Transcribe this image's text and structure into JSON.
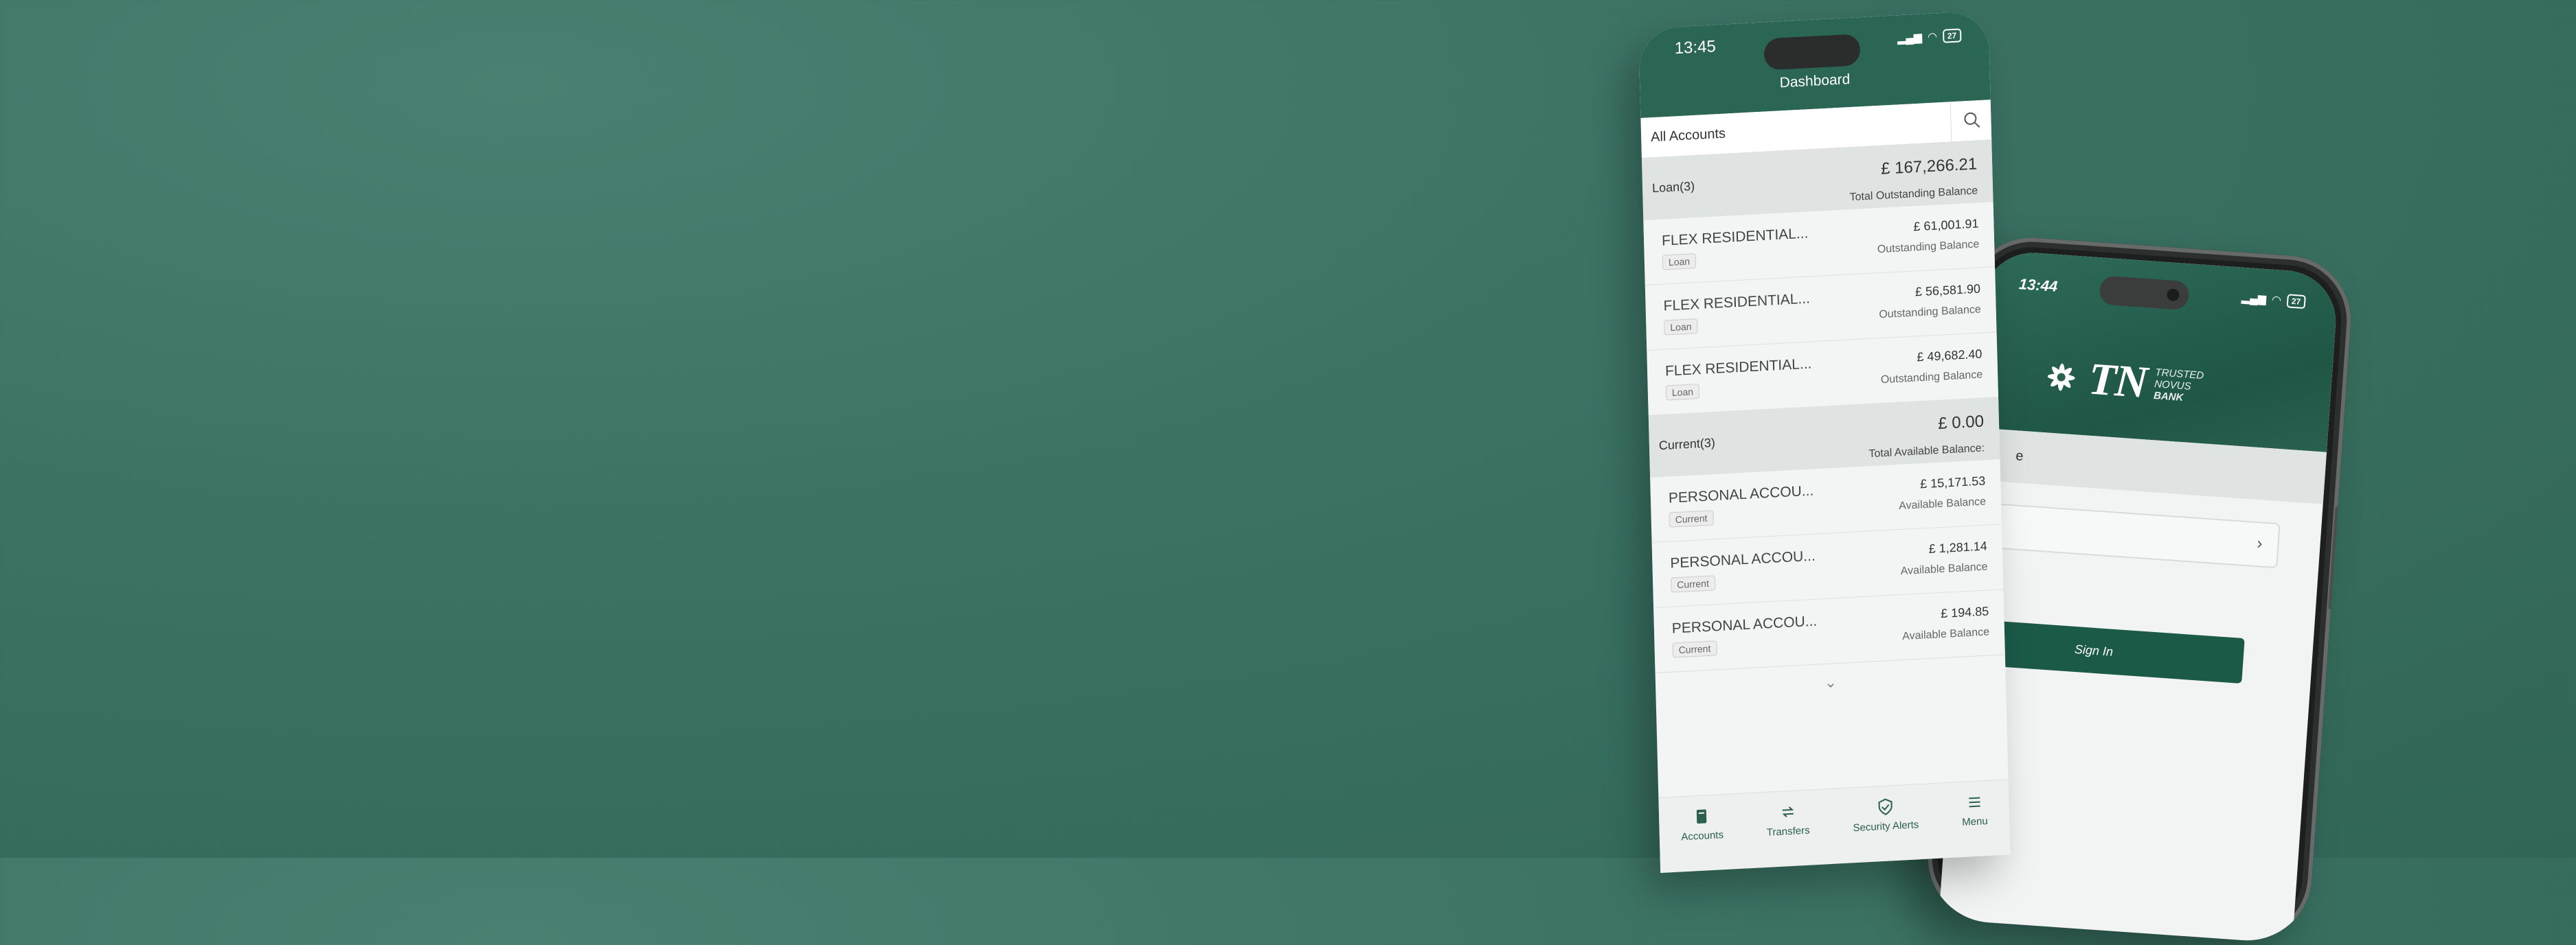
{
  "login_phone": {
    "time": "13:44",
    "battery": "27",
    "logo_letters": "TN",
    "logo_words": [
      "TRUSTED",
      "NOVUS",
      "BANK"
    ],
    "greeting_fragment": "e",
    "field_fragment": "e:",
    "sign_in_label": "Sign In"
  },
  "dashboard_phone": {
    "time": "13:45",
    "battery": "27",
    "title": "Dashboard",
    "account_filter": "All Accounts",
    "groups": [
      {
        "name": "Loan(3)",
        "amount": "£ 167,266.21",
        "sub": "Total Outstanding Balance",
        "rows": [
          {
            "name": "FLEX RESIDENTIAL...",
            "tag": "Loan",
            "amount": "£ 61,001.91",
            "sub": "Outstanding Balance"
          },
          {
            "name": "FLEX RESIDENTIAL...",
            "tag": "Loan",
            "amount": "£ 56,581.90",
            "sub": "Outstanding Balance"
          },
          {
            "name": "FLEX RESIDENTIAL...",
            "tag": "Loan",
            "amount": "£ 49,682.40",
            "sub": "Outstanding Balance"
          }
        ]
      },
      {
        "name": "Current(3)",
        "amount": "£ 0.00",
        "sub": "Total Available Balance:",
        "rows": [
          {
            "name": "PERSONAL ACCOU...",
            "tag": "Current",
            "amount": "£ 15,171.53",
            "sub": "Available Balance"
          },
          {
            "name": "PERSONAL ACCOU...",
            "tag": "Current",
            "amount": "£ 1,281.14",
            "sub": "Available Balance"
          },
          {
            "name": "PERSONAL ACCOU...",
            "tag": "Current",
            "amount": "£ 194.85",
            "sub": "Available Balance"
          }
        ]
      }
    ],
    "tabs": [
      {
        "label": "Accounts",
        "icon": "accounts-icon"
      },
      {
        "label": "Transfers",
        "icon": "transfers-icon"
      },
      {
        "label": "Security Alerts",
        "icon": "shield-check-icon"
      },
      {
        "label": "Menu",
        "icon": "menu-icon"
      }
    ]
  },
  "colors": {
    "brand": "#2b6553",
    "background": "#3c7364",
    "button": "#1c5a48"
  }
}
